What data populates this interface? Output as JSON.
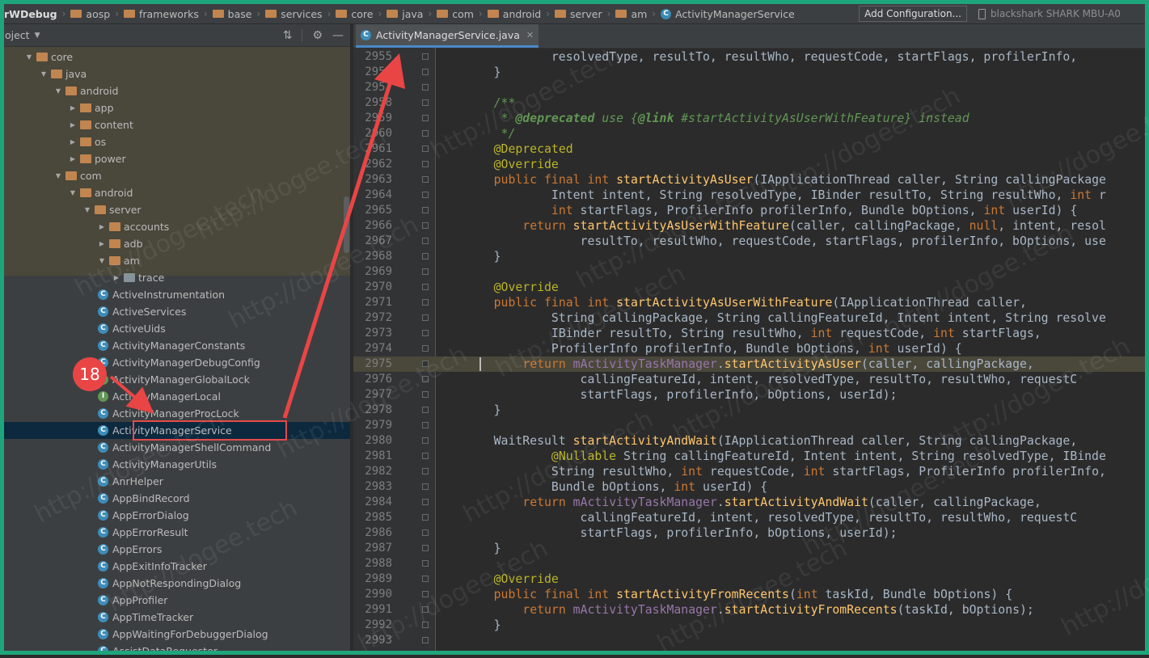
{
  "navbar": {
    "breadcrumbs": [
      {
        "label": "rWDebug",
        "icon": "project-icon"
      },
      {
        "label": "aosp",
        "icon": "folder-icon"
      },
      {
        "label": "frameworks",
        "icon": "folder-icon"
      },
      {
        "label": "base",
        "icon": "folder-icon"
      },
      {
        "label": "services",
        "icon": "folder-icon"
      },
      {
        "label": "core",
        "icon": "folder-icon"
      },
      {
        "label": "java",
        "icon": "folder-icon"
      },
      {
        "label": "com",
        "icon": "folder-icon"
      },
      {
        "label": "android",
        "icon": "folder-icon"
      },
      {
        "label": "server",
        "icon": "folder-icon"
      },
      {
        "label": "am",
        "icon": "folder-icon"
      },
      {
        "label": "ActivityManagerService",
        "icon": "class-icon"
      }
    ],
    "add_configuration": "Add Configuration...",
    "device": "blackshark SHARK MBU-A0"
  },
  "project_panel": {
    "title": "oject",
    "tree": [
      {
        "label": "core",
        "kind": "folder",
        "expanded": true
      },
      {
        "label": "java",
        "kind": "folder",
        "expanded": true
      },
      {
        "label": "android",
        "kind": "folder",
        "expanded": true
      },
      {
        "label": "app",
        "kind": "folder",
        "expanded": false
      },
      {
        "label": "content",
        "kind": "folder",
        "expanded": false
      },
      {
        "label": "os",
        "kind": "folder",
        "expanded": false
      },
      {
        "label": "power",
        "kind": "folder",
        "expanded": false
      },
      {
        "label": "com",
        "kind": "folder",
        "expanded": true
      },
      {
        "label": "android",
        "kind": "folder",
        "expanded": true
      },
      {
        "label": "server",
        "kind": "folder",
        "expanded": true
      },
      {
        "label": "accounts",
        "kind": "folder",
        "expanded": false
      },
      {
        "label": "adb",
        "kind": "folder",
        "expanded": false
      },
      {
        "label": "am",
        "kind": "folder",
        "expanded": true
      },
      {
        "label": "trace",
        "kind": "folder",
        "expanded": false
      },
      {
        "label": "ActiveInstrumentation",
        "kind": "class"
      },
      {
        "label": "ActiveServices",
        "kind": "class"
      },
      {
        "label": "ActiveUids",
        "kind": "class"
      },
      {
        "label": "ActivityManagerConstants",
        "kind": "class"
      },
      {
        "label": "ActivityManagerDebugConfig",
        "kind": "class"
      },
      {
        "label": "ActivityManagerGlobalLock",
        "kind": "interface"
      },
      {
        "label": "ActivityManagerLocal",
        "kind": "interface"
      },
      {
        "label": "ActivityManagerProcLock",
        "kind": "class"
      },
      {
        "label": "ActivityManagerService",
        "kind": "class",
        "selected": true
      },
      {
        "label": "ActivityManagerShellCommand",
        "kind": "class"
      },
      {
        "label": "ActivityManagerUtils",
        "kind": "class"
      },
      {
        "label": "AnrHelper",
        "kind": "class"
      },
      {
        "label": "AppBindRecord",
        "kind": "class"
      },
      {
        "label": "AppErrorDialog",
        "kind": "class"
      },
      {
        "label": "AppErrorResult",
        "kind": "class"
      },
      {
        "label": "AppErrors",
        "kind": "class"
      },
      {
        "label": "AppExitInfoTracker",
        "kind": "class"
      },
      {
        "label": "AppNotRespondingDialog",
        "kind": "class"
      },
      {
        "label": "AppProfiler",
        "kind": "class"
      },
      {
        "label": "AppTimeTracker",
        "kind": "class"
      },
      {
        "label": "AppWaitingForDebuggerDialog",
        "kind": "class"
      },
      {
        "label": "AssistDataRequester",
        "kind": "class"
      }
    ]
  },
  "annotation": {
    "step_number": "18"
  },
  "editor": {
    "tab_label": "ActivityManagerService.java",
    "highlighted_line": "2975",
    "lines": [
      {
        "n": "2955",
        "code": "            resolvedType, resultTo, resultWho, requestCode, startFlags, profilerInfo,"
      },
      {
        "n": "2956",
        "code": "    }"
      },
      {
        "n": "2957",
        "code": ""
      },
      {
        "n": "2958",
        "code": "    /**"
      },
      {
        "n": "2959",
        "code": "     * @deprecated use {@link #startActivityAsUserWithFeature} instead"
      },
      {
        "n": "2960",
        "code": "     */"
      },
      {
        "n": "2961",
        "code": "    @Deprecated"
      },
      {
        "n": "2962",
        "code": "    @Override"
      },
      {
        "n": "2963",
        "code": "    public final int startActivityAsUser(IApplicationThread caller, String callingPackage"
      },
      {
        "n": "2964",
        "code": "            Intent intent, String resolvedType, IBinder resultTo, String resultWho, int r"
      },
      {
        "n": "2965",
        "code": "            int startFlags, ProfilerInfo profilerInfo, Bundle bOptions, int userId) {"
      },
      {
        "n": "2966",
        "code": "        return startActivityAsUserWithFeature(caller, callingPackage, null, intent, resol"
      },
      {
        "n": "2967",
        "code": "                resultTo, resultWho, requestCode, startFlags, profilerInfo, bOptions, use"
      },
      {
        "n": "2968",
        "code": "    }"
      },
      {
        "n": "2969",
        "code": ""
      },
      {
        "n": "2970",
        "code": "    @Override"
      },
      {
        "n": "2971",
        "code": "    public final int startActivityAsUserWithFeature(IApplicationThread caller,"
      },
      {
        "n": "2972",
        "code": "            String callingPackage, String callingFeatureId, Intent intent, String resolve"
      },
      {
        "n": "2973",
        "code": "            IBinder resultTo, String resultWho, int requestCode, int startFlags,"
      },
      {
        "n": "2974",
        "code": "            ProfilerInfo profilerInfo, Bundle bOptions, int userId) {"
      },
      {
        "n": "2975",
        "code": "        return mActivityTaskManager.startActivityAsUser(caller, callingPackage,"
      },
      {
        "n": "2976",
        "code": "                callingFeatureId, intent, resolvedType, resultTo, resultWho, requestC"
      },
      {
        "n": "2977",
        "code": "                startFlags, profilerInfo, bOptions, userId);"
      },
      {
        "n": "2978",
        "code": "    }"
      },
      {
        "n": "2979",
        "code": ""
      },
      {
        "n": "2980",
        "code": "    WaitResult startActivityAndWait(IApplicationThread caller, String callingPackage,"
      },
      {
        "n": "2981",
        "code": "            @Nullable String callingFeatureId, Intent intent, String resolvedType, IBinde"
      },
      {
        "n": "2982",
        "code": "            String resultWho, int requestCode, int startFlags, ProfilerInfo profilerInfo,"
      },
      {
        "n": "2983",
        "code": "            Bundle bOptions, int userId) {"
      },
      {
        "n": "2984",
        "code": "        return mActivityTaskManager.startActivityAndWait(caller, callingPackage,"
      },
      {
        "n": "2985",
        "code": "                callingFeatureId, intent, resolvedType, resultTo, resultWho, requestC"
      },
      {
        "n": "2986",
        "code": "                startFlags, profilerInfo, bOptions, userId);"
      },
      {
        "n": "2987",
        "code": "    }"
      },
      {
        "n": "2988",
        "code": ""
      },
      {
        "n": "2989",
        "code": "    @Override"
      },
      {
        "n": "2990",
        "code": "    public final int startActivityFromRecents(int taskId, Bundle bOptions) {"
      },
      {
        "n": "2991",
        "code": "        return mActivityTaskManager.startActivityFromRecents(taskId, bOptions);"
      },
      {
        "n": "2992",
        "code": "    }"
      },
      {
        "n": "2993",
        "code": ""
      }
    ]
  },
  "watermark": "http://dogee.tech",
  "colors": {
    "frame": "#1fa57b",
    "annotation": "#e94545",
    "selection": "#0d293e",
    "keyword": "#cc7832",
    "method": "#ffc66d",
    "annotation_code": "#bbb529",
    "comment_doc": "#629755"
  }
}
